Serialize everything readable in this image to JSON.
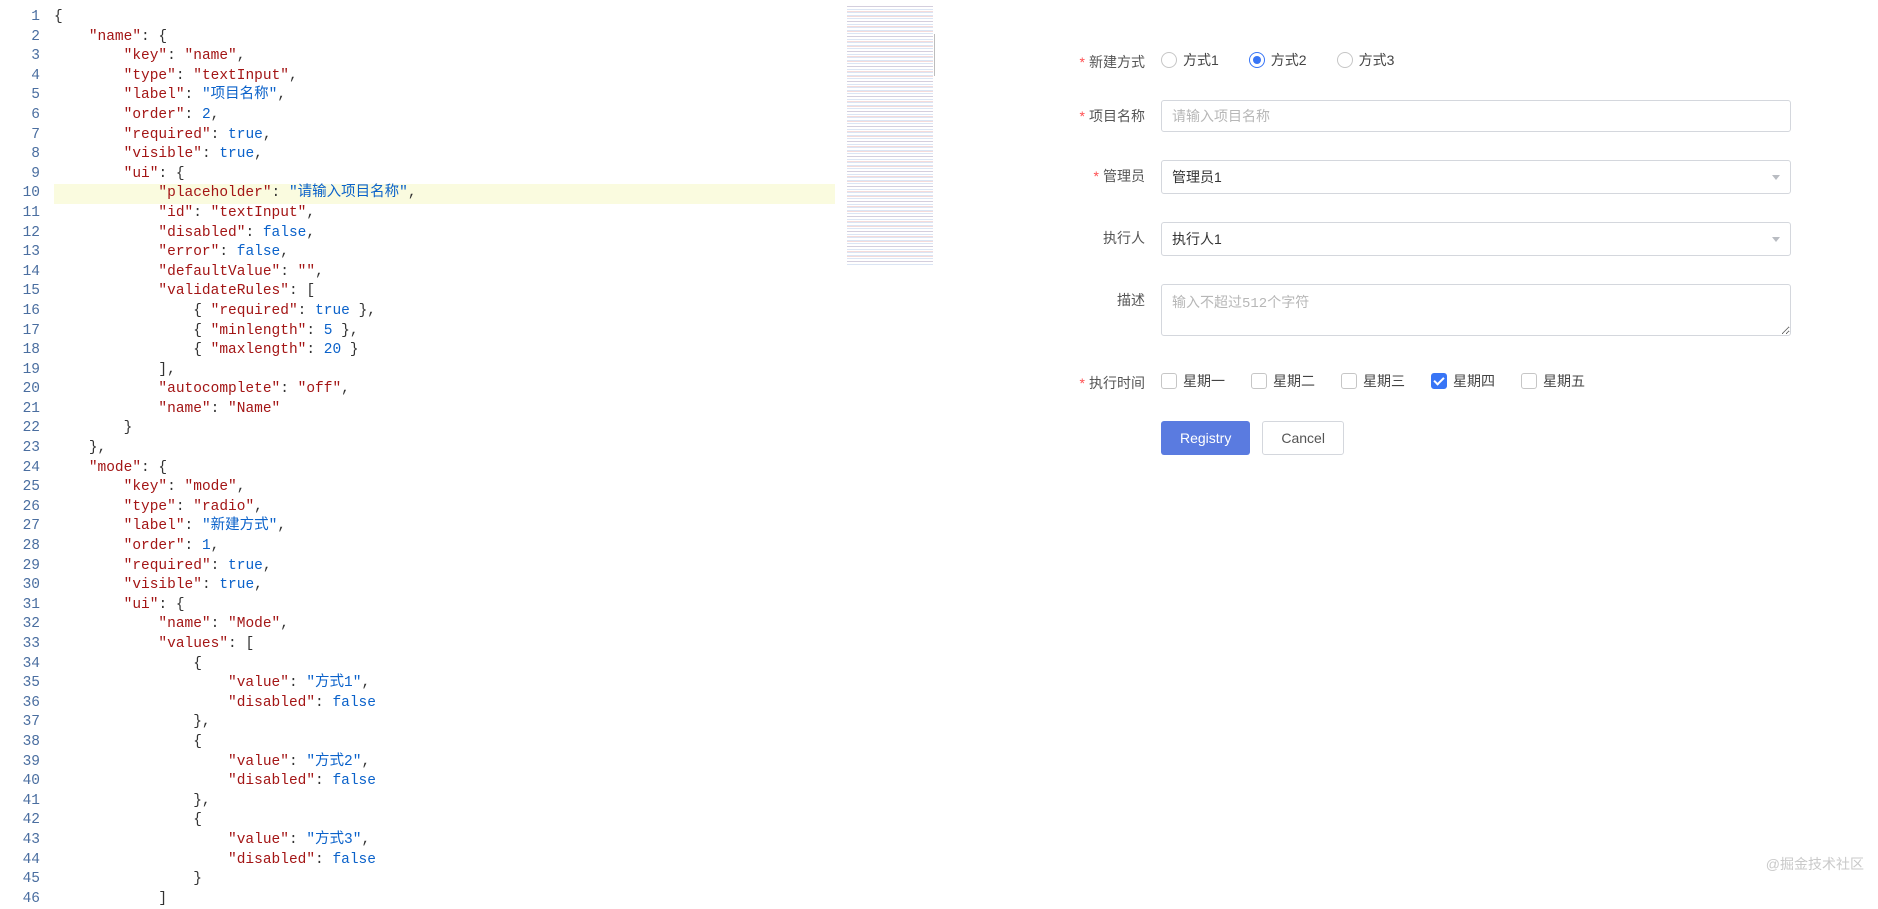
{
  "editor": {
    "highlight_line": 10,
    "visible_lines": 46,
    "code_lines": [
      {
        "indent": 0,
        "tokens": [
          {
            "t": "{",
            "c": "punc"
          }
        ]
      },
      {
        "indent": 1,
        "tokens": [
          {
            "t": "\"name\"",
            "c": "key"
          },
          {
            "t": ": {",
            "c": "punc"
          }
        ]
      },
      {
        "indent": 2,
        "tokens": [
          {
            "t": "\"key\"",
            "c": "key"
          },
          {
            "t": ": ",
            "c": "punc"
          },
          {
            "t": "\"name\"",
            "c": "key"
          },
          {
            "t": ",",
            "c": "punc"
          }
        ]
      },
      {
        "indent": 2,
        "tokens": [
          {
            "t": "\"type\"",
            "c": "key"
          },
          {
            "t": ": ",
            "c": "punc"
          },
          {
            "t": "\"textInput\"",
            "c": "key"
          },
          {
            "t": ",",
            "c": "punc"
          }
        ]
      },
      {
        "indent": 2,
        "tokens": [
          {
            "t": "\"label\"",
            "c": "key"
          },
          {
            "t": ": ",
            "c": "punc"
          },
          {
            "t": "\"项目名称\"",
            "c": "str"
          },
          {
            "t": ",",
            "c": "punc"
          }
        ]
      },
      {
        "indent": 2,
        "tokens": [
          {
            "t": "\"order\"",
            "c": "key"
          },
          {
            "t": ": ",
            "c": "punc"
          },
          {
            "t": "2",
            "c": "str"
          },
          {
            "t": ",",
            "c": "punc"
          }
        ]
      },
      {
        "indent": 2,
        "tokens": [
          {
            "t": "\"required\"",
            "c": "key"
          },
          {
            "t": ": ",
            "c": "punc"
          },
          {
            "t": "true",
            "c": "kw"
          },
          {
            "t": ",",
            "c": "punc"
          }
        ]
      },
      {
        "indent": 2,
        "tokens": [
          {
            "t": "\"visible\"",
            "c": "key"
          },
          {
            "t": ": ",
            "c": "punc"
          },
          {
            "t": "true",
            "c": "kw"
          },
          {
            "t": ",",
            "c": "punc"
          }
        ]
      },
      {
        "indent": 2,
        "tokens": [
          {
            "t": "\"ui\"",
            "c": "key"
          },
          {
            "t": ": {",
            "c": "punc"
          }
        ]
      },
      {
        "indent": 3,
        "tokens": [
          {
            "t": "\"placeholder\"",
            "c": "key"
          },
          {
            "t": ": ",
            "c": "punc"
          },
          {
            "t": "\"请输入项目名称\"",
            "c": "str"
          },
          {
            "t": ",",
            "c": "punc"
          }
        ]
      },
      {
        "indent": 3,
        "tokens": [
          {
            "t": "\"id\"",
            "c": "key"
          },
          {
            "t": ": ",
            "c": "punc"
          },
          {
            "t": "\"textInput\"",
            "c": "key"
          },
          {
            "t": ",",
            "c": "punc"
          }
        ]
      },
      {
        "indent": 3,
        "tokens": [
          {
            "t": "\"disabled\"",
            "c": "key"
          },
          {
            "t": ": ",
            "c": "punc"
          },
          {
            "t": "false",
            "c": "kw"
          },
          {
            "t": ",",
            "c": "punc"
          }
        ]
      },
      {
        "indent": 3,
        "tokens": [
          {
            "t": "\"error\"",
            "c": "key"
          },
          {
            "t": ": ",
            "c": "punc"
          },
          {
            "t": "false",
            "c": "kw"
          },
          {
            "t": ",",
            "c": "punc"
          }
        ]
      },
      {
        "indent": 3,
        "tokens": [
          {
            "t": "\"defaultValue\"",
            "c": "key"
          },
          {
            "t": ": ",
            "c": "punc"
          },
          {
            "t": "\"\"",
            "c": "key"
          },
          {
            "t": ",",
            "c": "punc"
          }
        ]
      },
      {
        "indent": 3,
        "tokens": [
          {
            "t": "\"validateRules\"",
            "c": "key"
          },
          {
            "t": ": [",
            "c": "punc"
          }
        ]
      },
      {
        "indent": 4,
        "tokens": [
          {
            "t": "{ ",
            "c": "punc"
          },
          {
            "t": "\"required\"",
            "c": "key"
          },
          {
            "t": ": ",
            "c": "punc"
          },
          {
            "t": "true",
            "c": "kw"
          },
          {
            "t": " },",
            "c": "punc"
          }
        ]
      },
      {
        "indent": 4,
        "tokens": [
          {
            "t": "{ ",
            "c": "punc"
          },
          {
            "t": "\"minlength\"",
            "c": "key"
          },
          {
            "t": ": ",
            "c": "punc"
          },
          {
            "t": "5",
            "c": "str"
          },
          {
            "t": " },",
            "c": "punc"
          }
        ]
      },
      {
        "indent": 4,
        "tokens": [
          {
            "t": "{ ",
            "c": "punc"
          },
          {
            "t": "\"maxlength\"",
            "c": "key"
          },
          {
            "t": ": ",
            "c": "punc"
          },
          {
            "t": "20",
            "c": "str"
          },
          {
            "t": " }",
            "c": "punc"
          }
        ]
      },
      {
        "indent": 3,
        "tokens": [
          {
            "t": "],",
            "c": "punc"
          }
        ]
      },
      {
        "indent": 3,
        "tokens": [
          {
            "t": "\"autocomplete\"",
            "c": "key"
          },
          {
            "t": ": ",
            "c": "punc"
          },
          {
            "t": "\"off\"",
            "c": "key"
          },
          {
            "t": ",",
            "c": "punc"
          }
        ]
      },
      {
        "indent": 3,
        "tokens": [
          {
            "t": "\"name\"",
            "c": "key"
          },
          {
            "t": ": ",
            "c": "punc"
          },
          {
            "t": "\"Name\"",
            "c": "key"
          }
        ]
      },
      {
        "indent": 2,
        "tokens": [
          {
            "t": "}",
            "c": "punc"
          }
        ]
      },
      {
        "indent": 1,
        "tokens": [
          {
            "t": "},",
            "c": "punc"
          }
        ]
      },
      {
        "indent": 1,
        "tokens": [
          {
            "t": "\"mode\"",
            "c": "key"
          },
          {
            "t": ": {",
            "c": "punc"
          }
        ]
      },
      {
        "indent": 2,
        "tokens": [
          {
            "t": "\"key\"",
            "c": "key"
          },
          {
            "t": ": ",
            "c": "punc"
          },
          {
            "t": "\"mode\"",
            "c": "key"
          },
          {
            "t": ",",
            "c": "punc"
          }
        ]
      },
      {
        "indent": 2,
        "tokens": [
          {
            "t": "\"type\"",
            "c": "key"
          },
          {
            "t": ": ",
            "c": "punc"
          },
          {
            "t": "\"radio\"",
            "c": "key"
          },
          {
            "t": ",",
            "c": "punc"
          }
        ]
      },
      {
        "indent": 2,
        "tokens": [
          {
            "t": "\"label\"",
            "c": "key"
          },
          {
            "t": ": ",
            "c": "punc"
          },
          {
            "t": "\"新建方式\"",
            "c": "str"
          },
          {
            "t": ",",
            "c": "punc"
          }
        ]
      },
      {
        "indent": 2,
        "tokens": [
          {
            "t": "\"order\"",
            "c": "key"
          },
          {
            "t": ": ",
            "c": "punc"
          },
          {
            "t": "1",
            "c": "str"
          },
          {
            "t": ",",
            "c": "punc"
          }
        ]
      },
      {
        "indent": 2,
        "tokens": [
          {
            "t": "\"required\"",
            "c": "key"
          },
          {
            "t": ": ",
            "c": "punc"
          },
          {
            "t": "true",
            "c": "kw"
          },
          {
            "t": ",",
            "c": "punc"
          }
        ]
      },
      {
        "indent": 2,
        "tokens": [
          {
            "t": "\"visible\"",
            "c": "key"
          },
          {
            "t": ": ",
            "c": "punc"
          },
          {
            "t": "true",
            "c": "kw"
          },
          {
            "t": ",",
            "c": "punc"
          }
        ]
      },
      {
        "indent": 2,
        "tokens": [
          {
            "t": "\"ui\"",
            "c": "key"
          },
          {
            "t": ": {",
            "c": "punc"
          }
        ]
      },
      {
        "indent": 3,
        "tokens": [
          {
            "t": "\"name\"",
            "c": "key"
          },
          {
            "t": ": ",
            "c": "punc"
          },
          {
            "t": "\"Mode\"",
            "c": "key"
          },
          {
            "t": ",",
            "c": "punc"
          }
        ]
      },
      {
        "indent": 3,
        "tokens": [
          {
            "t": "\"values\"",
            "c": "key"
          },
          {
            "t": ": [",
            "c": "punc"
          }
        ]
      },
      {
        "indent": 4,
        "tokens": [
          {
            "t": "{",
            "c": "punc"
          }
        ]
      },
      {
        "indent": 5,
        "tokens": [
          {
            "t": "\"value\"",
            "c": "key"
          },
          {
            "t": ": ",
            "c": "punc"
          },
          {
            "t": "\"方式1\"",
            "c": "str"
          },
          {
            "t": ",",
            "c": "punc"
          }
        ]
      },
      {
        "indent": 5,
        "tokens": [
          {
            "t": "\"disabled\"",
            "c": "key"
          },
          {
            "t": ": ",
            "c": "punc"
          },
          {
            "t": "false",
            "c": "kw"
          }
        ]
      },
      {
        "indent": 4,
        "tokens": [
          {
            "t": "},",
            "c": "punc"
          }
        ]
      },
      {
        "indent": 4,
        "tokens": [
          {
            "t": "{",
            "c": "punc"
          }
        ]
      },
      {
        "indent": 5,
        "tokens": [
          {
            "t": "\"value\"",
            "c": "key"
          },
          {
            "t": ": ",
            "c": "punc"
          },
          {
            "t": "\"方式2\"",
            "c": "str"
          },
          {
            "t": ",",
            "c": "punc"
          }
        ]
      },
      {
        "indent": 5,
        "tokens": [
          {
            "t": "\"disabled\"",
            "c": "key"
          },
          {
            "t": ": ",
            "c": "punc"
          },
          {
            "t": "false",
            "c": "kw"
          }
        ]
      },
      {
        "indent": 4,
        "tokens": [
          {
            "t": "},",
            "c": "punc"
          }
        ]
      },
      {
        "indent": 4,
        "tokens": [
          {
            "t": "{",
            "c": "punc"
          }
        ]
      },
      {
        "indent": 5,
        "tokens": [
          {
            "t": "\"value\"",
            "c": "key"
          },
          {
            "t": ": ",
            "c": "punc"
          },
          {
            "t": "\"方式3\"",
            "c": "str"
          },
          {
            "t": ",",
            "c": "punc"
          }
        ]
      },
      {
        "indent": 5,
        "tokens": [
          {
            "t": "\"disabled\"",
            "c": "key"
          },
          {
            "t": ": ",
            "c": "punc"
          },
          {
            "t": "false",
            "c": "kw"
          }
        ]
      },
      {
        "indent": 4,
        "tokens": [
          {
            "t": "}",
            "c": "punc"
          }
        ]
      },
      {
        "indent": 3,
        "tokens": [
          {
            "t": "]",
            "c": "punc"
          }
        ]
      }
    ]
  },
  "form": {
    "mode": {
      "label": "新建方式",
      "required": true,
      "options": [
        "方式1",
        "方式2",
        "方式3"
      ],
      "selected_index": 1
    },
    "name": {
      "label": "项目名称",
      "required": true,
      "placeholder": "请输入项目名称",
      "value": ""
    },
    "admin": {
      "label": "管理员",
      "required": true,
      "value": "管理员1"
    },
    "executor": {
      "label": "执行人",
      "required": false,
      "value": "执行人1"
    },
    "desc": {
      "label": "描述",
      "required": false,
      "placeholder": "输入不超过512个字符",
      "value": ""
    },
    "exec_time": {
      "label": "执行时间",
      "required": true,
      "options": [
        "星期一",
        "星期二",
        "星期三",
        "星期四",
        "星期五"
      ],
      "checked": [
        false,
        false,
        false,
        true,
        false
      ]
    },
    "buttons": {
      "primary": "Registry",
      "cancel": "Cancel"
    }
  },
  "watermark": "@掘金技术社区"
}
